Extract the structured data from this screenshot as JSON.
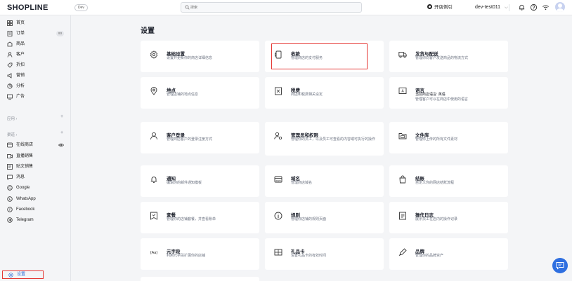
{
  "header": {
    "logo": "SHOPLINE",
    "env_badge": "Dev",
    "search_placeholder": "搜索",
    "store_status": "开店例引",
    "store_name": "dev-test011"
  },
  "sidebar": {
    "items": [
      {
        "label": "首页",
        "icon": "home-icon"
      },
      {
        "label": "订单",
        "icon": "orders-icon",
        "badge": "93"
      },
      {
        "label": "商品",
        "icon": "products-icon"
      },
      {
        "label": "客户",
        "icon": "customers-icon"
      },
      {
        "label": "折扣",
        "icon": "discount-icon"
      },
      {
        "label": "营销",
        "icon": "marketing-icon"
      },
      {
        "label": "分析",
        "icon": "analytics-icon"
      },
      {
        "label": "广告",
        "icon": "ads-icon"
      }
    ],
    "apps_section": "应用",
    "channels_section": "渠道",
    "channels": [
      {
        "label": "在线商店",
        "icon": "online-store-icon"
      },
      {
        "label": "直播销售",
        "icon": "live-sales-icon"
      },
      {
        "label": "贴文销售",
        "icon": "post-sales-icon"
      },
      {
        "label": "消息",
        "icon": "message-icon"
      },
      {
        "label": "Google",
        "icon": "google-icon"
      },
      {
        "label": "WhatsApp",
        "icon": "whatsapp-icon"
      },
      {
        "label": "Facebook",
        "icon": "facebook-icon"
      },
      {
        "label": "Telegram",
        "icon": "telegram-icon"
      }
    ],
    "settings_label": "设置"
  },
  "main": {
    "title": "设置",
    "cards": [
      {
        "title": "基础设置",
        "desc": "设置并更新你的商店详细信息",
        "icon": "gear-icon"
      },
      {
        "title": "收款",
        "desc": "管理商店的支付服务",
        "icon": "payment-icon"
      },
      {
        "title": "发货与配送",
        "desc": "管理你向客户发送商品的物流方式",
        "icon": "truck-icon"
      },
      {
        "title": "地点",
        "desc": "管理店铺的地点信息",
        "icon": "location-icon"
      },
      {
        "title": "税费",
        "desc": "商店和税费相关设定",
        "icon": "tax-icon"
      },
      {
        "title": "语言",
        "desc_primary": "当前商店语言: 英语",
        "desc": "管理客户可以在商店中使用的语言",
        "icon": "language-icon"
      },
      {
        "title": "客户登录",
        "desc": "管理商店客户的登录注册方式",
        "icon": "customer-login-icon"
      },
      {
        "title": "管理员和权限",
        "desc": "管理你的员工，以及员工可查看的内容或可执行的操作",
        "icon": "admin-permissions-icon"
      },
      {
        "title": "文件库",
        "desc": "管理你上传的所有文件素材",
        "icon": "folder-icon"
      },
      {
        "title": "通知",
        "desc": "编辑你的邮件通知模板",
        "icon": "bell-icon"
      },
      {
        "title": "域名",
        "desc": "管理商店域名",
        "icon": "domain-icon"
      },
      {
        "title": "结账",
        "desc": "自定义你的网店结账流程",
        "icon": "checkout-bag-icon"
      },
      {
        "title": "套餐",
        "desc": "管理你的店铺套餐，并查看账单",
        "icon": "plan-icon"
      },
      {
        "title": "规则",
        "desc": "管理你店铺的规则页面",
        "icon": "info-icon"
      },
      {
        "title": "操作日志",
        "desc": "展示员工在店内的操作记录",
        "icon": "log-icon"
      },
      {
        "title": "元字段",
        "desc": "利用元字段扩展你的店铺",
        "icon": "metafield-icon"
      },
      {
        "title": "礼品卡",
        "desc": "设置礼品卡的有效时间",
        "icon": "gift-card-icon"
      },
      {
        "title": "品牌",
        "desc": "管理你的品牌资产",
        "icon": "brand-icon"
      }
    ]
  }
}
